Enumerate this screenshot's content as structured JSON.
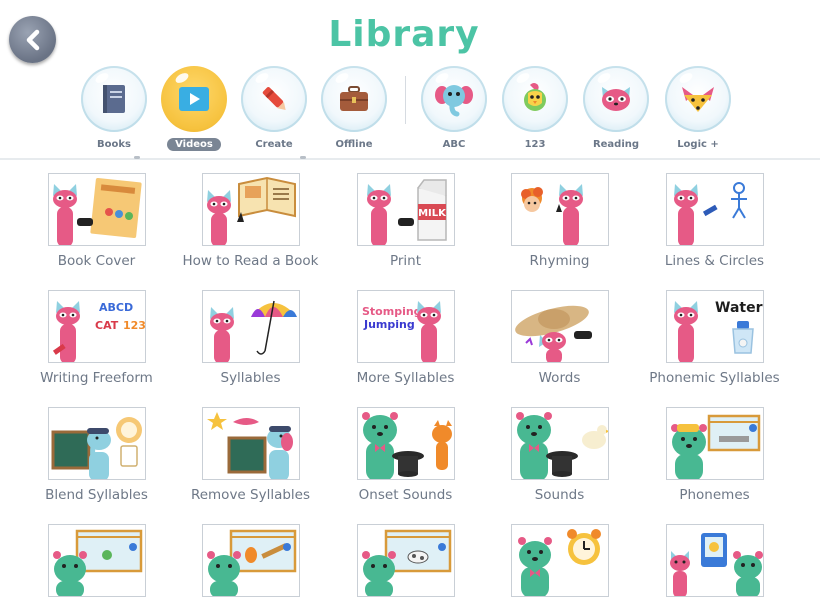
{
  "header": {
    "title": "Library",
    "back_icon": "chevron-left-icon"
  },
  "nav": {
    "items": [
      {
        "label": "Books",
        "icon": "book-icon",
        "active": false
      },
      {
        "label": "Videos",
        "icon": "play-icon",
        "active": true
      },
      {
        "label": "Create",
        "icon": "crayon-icon",
        "active": false
      },
      {
        "label": "Offline",
        "icon": "suitcase-icon",
        "active": false
      },
      {
        "label": "ABC",
        "icon": "elephant-icon",
        "active": false
      },
      {
        "label": "123",
        "icon": "bird-icon",
        "active": false
      },
      {
        "label": "Reading",
        "icon": "red-panda-icon",
        "active": false
      },
      {
        "label": "Logic +",
        "icon": "fox-icon",
        "active": false
      }
    ]
  },
  "videos": [
    {
      "label": "Book Cover",
      "character": "red-panda"
    },
    {
      "label": "How to Read a Book",
      "character": "red-panda"
    },
    {
      "label": "Print",
      "character": "red-panda"
    },
    {
      "label": "Rhyming",
      "character": "red-panda"
    },
    {
      "label": "Lines & Circles",
      "character": "red-panda"
    },
    {
      "label": "Writing Freeform",
      "character": "red-panda",
      "thumb_text": [
        "ABCD",
        "CAT",
        "123"
      ]
    },
    {
      "label": "Syllables",
      "character": "red-panda"
    },
    {
      "label": "More Syllables",
      "character": "red-panda",
      "thumb_text": [
        "Stomping",
        "Jumping"
      ]
    },
    {
      "label": "Words",
      "character": "red-panda"
    },
    {
      "label": "Phonemic Syllables",
      "character": "red-panda",
      "thumb_text": [
        "Water"
      ]
    },
    {
      "label": "Blend Syllables",
      "character": "elephant"
    },
    {
      "label": "Remove Syllables",
      "character": "elephant"
    },
    {
      "label": "Onset Sounds",
      "character": "bear"
    },
    {
      "label": "Sounds",
      "character": "bear"
    },
    {
      "label": "Phonemes",
      "character": "bear"
    },
    {
      "label": "",
      "character": "bear"
    },
    {
      "label": "",
      "character": "bear"
    },
    {
      "label": "",
      "character": "bear"
    },
    {
      "label": "",
      "character": "bear"
    },
    {
      "label": "",
      "character": "bear"
    }
  ],
  "thumb_text_samples": {
    "milk": "MILK"
  },
  "colors": {
    "accent": "#4cc4a5",
    "active_nav": "#f6c23e",
    "panda_pink": "#e65a86",
    "bear_green": "#48b892"
  }
}
